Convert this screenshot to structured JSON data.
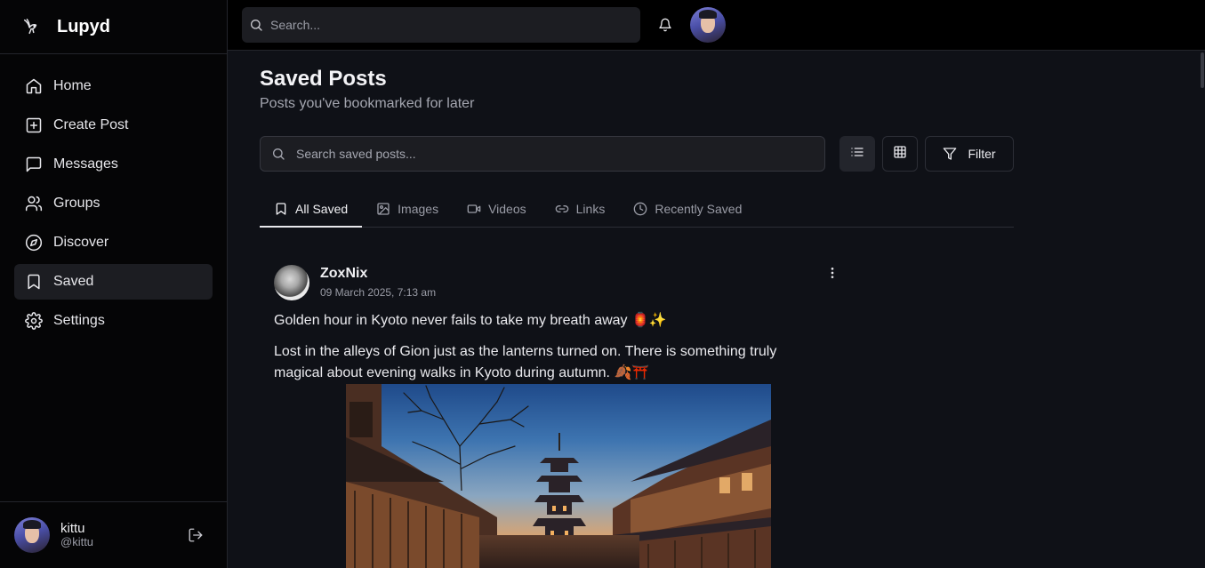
{
  "brand": {
    "name": "Lupyd",
    "logo_icon": "bird-logo-icon"
  },
  "sidebar": {
    "items": [
      {
        "label": "Home",
        "icon": "home-icon",
        "active": false
      },
      {
        "label": "Create Post",
        "icon": "plus-square-icon",
        "active": false
      },
      {
        "label": "Messages",
        "icon": "message-square-icon",
        "active": false
      },
      {
        "label": "Groups",
        "icon": "users-icon",
        "active": false
      },
      {
        "label": "Discover",
        "icon": "compass-icon",
        "active": false
      },
      {
        "label": "Saved",
        "icon": "bookmark-icon",
        "active": true
      },
      {
        "label": "Settings",
        "icon": "gear-icon",
        "active": false
      }
    ]
  },
  "user": {
    "name": "kittu",
    "handle": "@kittu"
  },
  "topbar": {
    "search_placeholder": "Search..."
  },
  "page": {
    "title": "Saved Posts",
    "subtitle": "Posts you've bookmarked for later",
    "search_placeholder": "Search saved posts...",
    "filter_label": "Filter",
    "view_mode": "list"
  },
  "tabs": [
    {
      "label": "All Saved",
      "icon": "bookmark-icon",
      "active": true
    },
    {
      "label": "Images",
      "icon": "image-icon",
      "active": false
    },
    {
      "label": "Videos",
      "icon": "video-icon",
      "active": false
    },
    {
      "label": "Links",
      "icon": "link-icon",
      "active": false
    },
    {
      "label": "Recently Saved",
      "icon": "clock-icon",
      "active": false
    }
  ],
  "post": {
    "author": "ZoxNix",
    "date": "09 March 2025, 7:13 am",
    "title": "Golden hour in Kyoto never fails to take my breath away 🏮✨",
    "body": "Lost in the alleys of Gion just as the lanterns turned on. There is something truly magical about evening walks in Kyoto during autumn. 🍂⛩️"
  },
  "colors": {
    "background": "#0f1117",
    "sidebar": "#050506",
    "topbar": "#000000",
    "active_item": "#1c1d22",
    "muted_text": "#9a9ca6"
  }
}
